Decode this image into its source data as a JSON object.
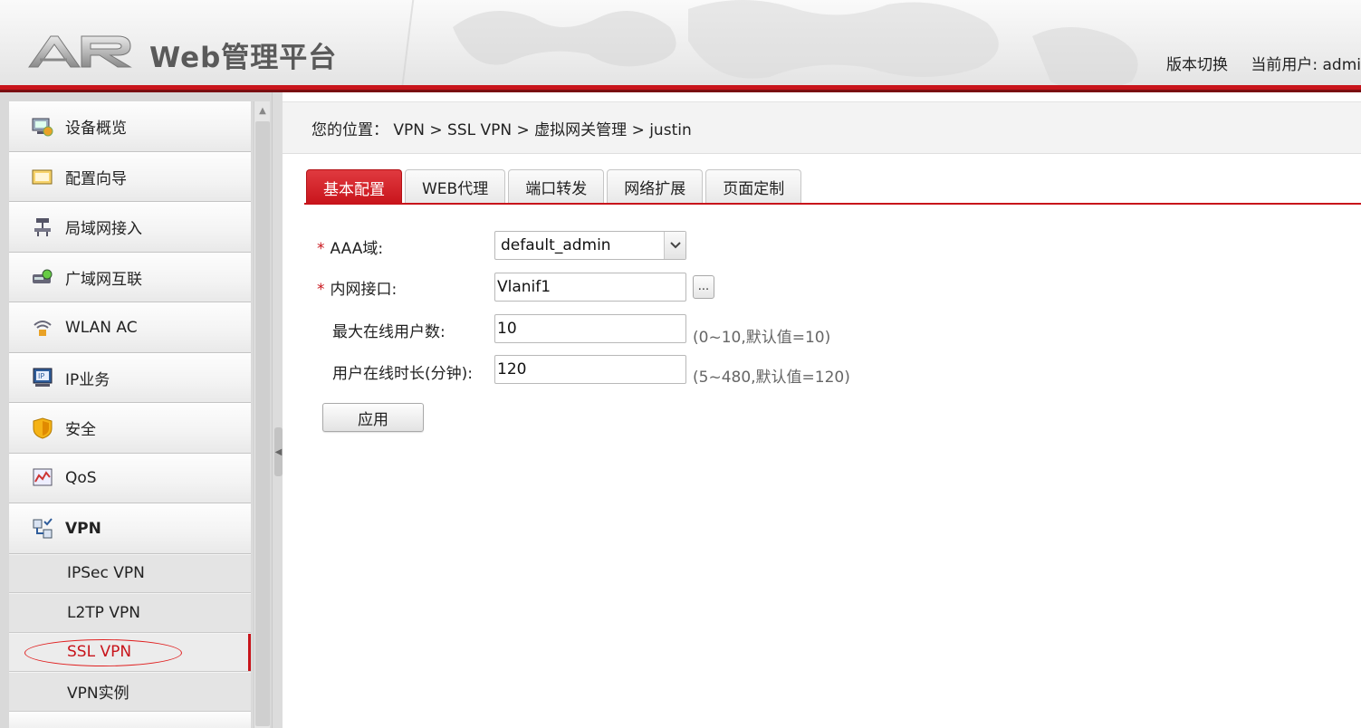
{
  "header": {
    "logo_text": "AR",
    "title": "Web管理平台",
    "links": [
      "版本切换",
      "当前用户: admi"
    ]
  },
  "sidebar": {
    "items": [
      {
        "label": "设备概览",
        "icon": "device-overview-icon"
      },
      {
        "label": "配置向导",
        "icon": "config-wizard-icon"
      },
      {
        "label": "局域网接入",
        "icon": "lan-access-icon"
      },
      {
        "label": "广域网互联",
        "icon": "wan-interconnect-icon"
      },
      {
        "label": "WLAN AC",
        "icon": "wlan-icon"
      },
      {
        "label": "IP业务",
        "icon": "ip-service-icon"
      },
      {
        "label": "安全",
        "icon": "security-shield-icon"
      },
      {
        "label": "QoS",
        "icon": "qos-icon"
      },
      {
        "label": "VPN",
        "icon": "vpn-icon"
      }
    ],
    "vpn_subitems": [
      "IPSec VPN",
      "L2TP VPN",
      "SSL VPN",
      "VPN实例"
    ],
    "active_subitem": "SSL VPN"
  },
  "breadcrumb": "您的位置： VPN > SSL VPN > 虚拟网关管理 > justin",
  "tabs": [
    "基本配置",
    "WEB代理",
    "端口转发",
    "网络扩展",
    "页面定制"
  ],
  "active_tab": "基本配置",
  "form": {
    "aaa_label": "AAA域:",
    "aaa_value": "default_admin",
    "intf_label": "内网接口:",
    "intf_value": "Vlanif1",
    "intf_button": "...",
    "max_users_label": "最大在线用户数:",
    "max_users_value": "10",
    "max_users_hint": "(0~10,默认值=10)",
    "online_time_label": "用户在线时长(分钟):",
    "online_time_value": "120",
    "online_time_hint": "(5~480,默认值=120)",
    "required_mark": "*",
    "apply_label": "应用"
  },
  "colors": {
    "accent": "#c8141b",
    "annotation_circle": "#e02020"
  }
}
